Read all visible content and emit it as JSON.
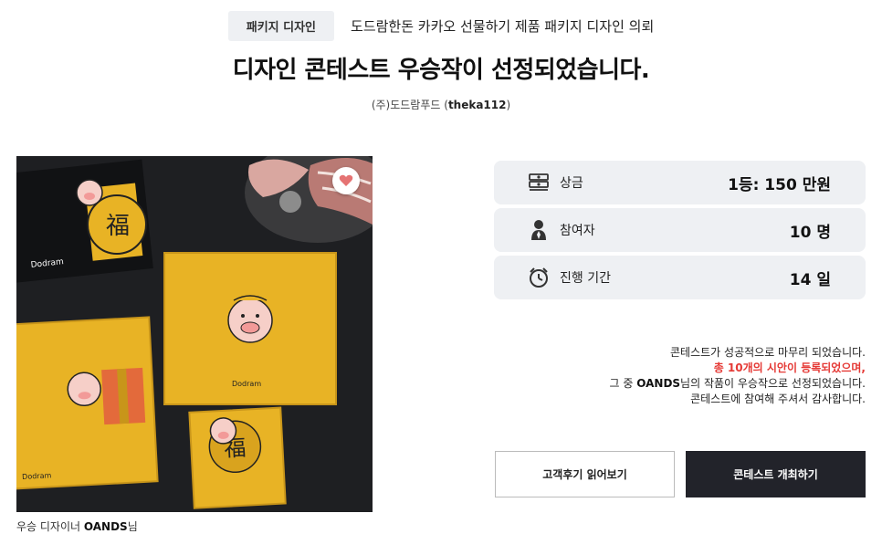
{
  "header": {
    "category": "패키지 디자인",
    "subtitle": "도드람한돈 카카오 선물하기 제품 패키지 디자인 의뢰"
  },
  "headline": "디자인 콘테스트 우승작이 선정되었습니다.",
  "host": {
    "company": "(주)도드람푸드 (",
    "user_id": "theka112",
    "suffix": ")"
  },
  "image": {
    "brand_mark": "Dodram",
    "lucky_char": "福"
  },
  "designer_caption": {
    "prefix": "우승 디자이너 ",
    "name": "OANDS",
    "suffix": "님"
  },
  "stats": [
    {
      "icon": "money-icon",
      "label": "상금",
      "value": "1등: 150 만원"
    },
    {
      "icon": "person-icon",
      "label": "참여자",
      "value": "10 명"
    },
    {
      "icon": "clock-icon",
      "label": "진행 기간",
      "value": "14 일"
    }
  ],
  "result": {
    "line1": "콘테스트가 성공적으로 마무리 되었습니다.",
    "line2": "총 10개의 시안이 등록되었으며,",
    "line3_prefix": "그 중 ",
    "line3_name": "OANDS",
    "line3_suffix": "님의 작품이 우승작으로 선정되었습니다.",
    "line4": "콘테스트에 참여해 주셔서 감사합니다."
  },
  "buttons": {
    "reviews": "고객후기 읽어보기",
    "host_contest": "콘테스트 개최하기"
  },
  "colors": {
    "accent_red": "#e53935",
    "dark_button": "#22232a",
    "card_bg": "#eef0f3",
    "package_yellow": "#e8b325"
  }
}
